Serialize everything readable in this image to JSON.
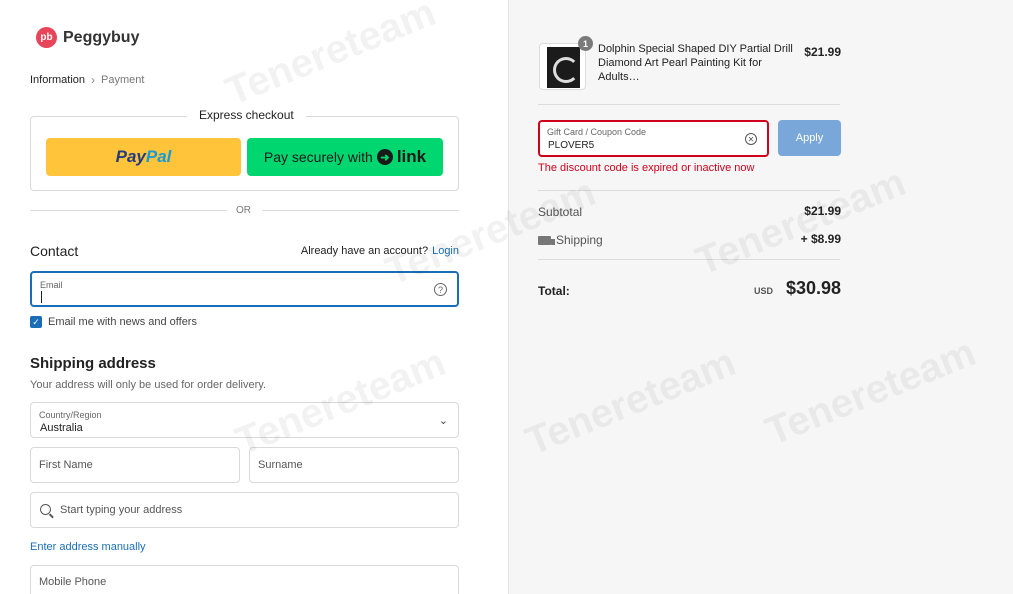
{
  "brand": {
    "logo_mark": "pb",
    "name": "Peggybuy",
    "accent": "#e8445a"
  },
  "breadcrumb": {
    "step1": "Information",
    "step2": "Payment"
  },
  "express": {
    "title": "Express checkout",
    "paypal_part1": "Pay",
    "paypal_part2": "Pal",
    "link_text": "Pay securely with",
    "link_brand": "link",
    "or": "OR"
  },
  "contact": {
    "heading": "Contact",
    "account_text": "Already have an account?",
    "login": "Login",
    "email_label": "Email",
    "email_value": "",
    "news_label": "Email me with news and offers",
    "news_checked": true
  },
  "shipping": {
    "heading": "Shipping address",
    "subtitle": "Your address will only be used for order delivery.",
    "country_label": "Country/Region",
    "country_value": "Australia",
    "first_name_placeholder": "First Name",
    "surname_placeholder": "Surname",
    "address_placeholder": "Start typing your address",
    "manual_link": "Enter address manually",
    "phone_placeholder": "Mobile Phone"
  },
  "order": {
    "quantity": "1",
    "product_name": "Dolphin Special Shaped DIY Partial Drill Diamond Art Pearl Painting Kit for Adults…",
    "product_price": "$21.99",
    "coupon_label": "Gift Card / Coupon Code",
    "coupon_value": "PLOVER5",
    "apply": "Apply",
    "coupon_error": "The discount code is expired or inactive now",
    "subtotal_label": "Subtotal",
    "subtotal_value": "$21.99",
    "shipping_label": "Shipping",
    "shipping_value": "+ $8.99",
    "total_label": "Total:",
    "total_currency": "USD",
    "total_value": "$30.98"
  },
  "watermark": "Tenereteam"
}
